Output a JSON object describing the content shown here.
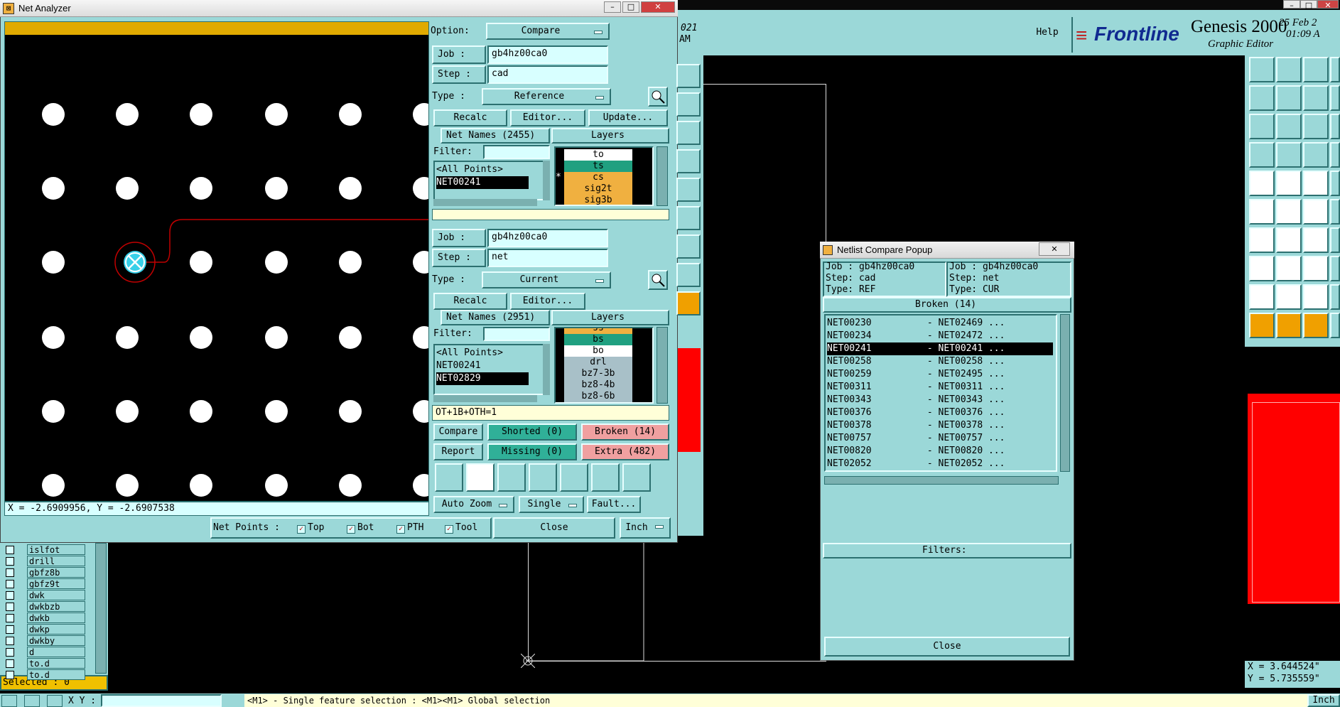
{
  "net_analyzer": {
    "title": "Net Analyzer",
    "coord_readout": "X = -2.6909956, Y = -2.6907538",
    "option_label": "Option:",
    "option_value": "Compare",
    "ref": {
      "job_label": "Job  :",
      "job_value": "gb4hz00ca0",
      "step_label": "Step :",
      "step_value": "cad",
      "type_label": "Type :",
      "type_value": "Reference",
      "recalc": "Recalc",
      "editor": "Editor...",
      "update": "Update...",
      "net_names": "Net Names (2455)",
      "layers": "Layers",
      "filter_label": "Filter:",
      "nets": [
        "<All Points>",
        "NET00241"
      ],
      "layer_items": [
        {
          "name": "to",
          "color": "#ffffff",
          "mark": ""
        },
        {
          "name": "ts",
          "color": "#20a080",
          "mark": ""
        },
        {
          "name": "cs",
          "color": "#f0b040",
          "mark": "*"
        },
        {
          "name": "sig2t",
          "color": "#f0b040",
          "mark": ""
        },
        {
          "name": "sig3b",
          "color": "#f0b040",
          "mark": ""
        }
      ]
    },
    "cur": {
      "job_label": "Job  :",
      "job_value": "gb4hz00ca0",
      "step_label": "Step :",
      "step_value": "net",
      "type_label": "Type :",
      "type_value": "Current",
      "recalc": "Recalc",
      "editor": "Editor...",
      "net_names": "Net Names (2951)",
      "layers": "Layers",
      "filter_label": "Filter:",
      "nets": [
        "<All Points>",
        "NET00241",
        "NET02829"
      ],
      "layer_items": [
        {
          "name": "ss",
          "color": "#f0b040"
        },
        {
          "name": "bs",
          "color": "#20a080"
        },
        {
          "name": "bo",
          "color": "#ffffff"
        },
        {
          "name": "drl",
          "color": "#a8c0c8"
        },
        {
          "name": "bz7-3b",
          "color": "#a8c0c8"
        },
        {
          "name": "bz8-4b",
          "color": "#a8c0c8"
        },
        {
          "name": "bz8-6b",
          "color": "#a8c0c8"
        }
      ]
    },
    "status_line": "OT+1B+OTH=1",
    "compare": "Compare",
    "report": "Report",
    "shorted": "Shorted (0)",
    "missing": "Missing (0)",
    "broken": "Broken (14)",
    "extra": "Extra (482)",
    "auto_zoom": "Auto Zoom",
    "single": "Single",
    "fault": "Fault...",
    "net_points_label": "Net Points :",
    "np_top": "Top",
    "np_bot": "Bot",
    "np_pth": "PTH",
    "np_tool": "Tool",
    "close": "Close",
    "units": "Inch"
  },
  "netlist_popup": {
    "title": "Netlist Compare Popup",
    "ref_job": "Job  : gb4hz00ca0",
    "ref_step": "Step: cad",
    "ref_type": "Type: REF",
    "cur_job": "Job  : gb4hz00ca0",
    "cur_step": "Step: net",
    "cur_type": "Type: CUR",
    "broken_header": "Broken (14)",
    "rows": [
      "NET00230          - NET02469 ...",
      "NET00234          - NET02472 ...",
      "NET00241          - NET00241 ...",
      "NET00258          - NET00258 ...",
      "NET00259          - NET02495 ...",
      "NET00311          - NET00311 ...",
      "NET00343          - NET00343 ...",
      "NET00376          - NET00376 ...",
      "NET00378          - NET00378 ...",
      "NET00757          - NET00757 ...",
      "NET00820          - NET00820 ...",
      "NET02052          - NET02052 ..."
    ],
    "filters_label": "Filters:",
    "close": "Close"
  },
  "editor": {
    "help": "Help",
    "brand": "Frontline",
    "product": "Genesis 2000",
    "subtitle": "Graphic Editor",
    "date": "25 Feb 2",
    "time": "01:09 A",
    "partial_year": "021",
    "partial_am": "AM",
    "coord_x": "X = 3.644524\"",
    "coord_y": "Y = 5.735559\"",
    "selected": "Selected : 0",
    "status_hint": "<M1> - Single feature selection : <M1><M1> Global selection",
    "xy_label": "X Y :",
    "inch_btn": "Inch",
    "layers_list": [
      "islfot",
      "drill",
      "gbfz8b",
      "gbfz9t",
      "dwk",
      "dwkbzb",
      "dwkb",
      "dwkp",
      "dwkby",
      "d",
      "to.d",
      "to.d"
    ]
  }
}
